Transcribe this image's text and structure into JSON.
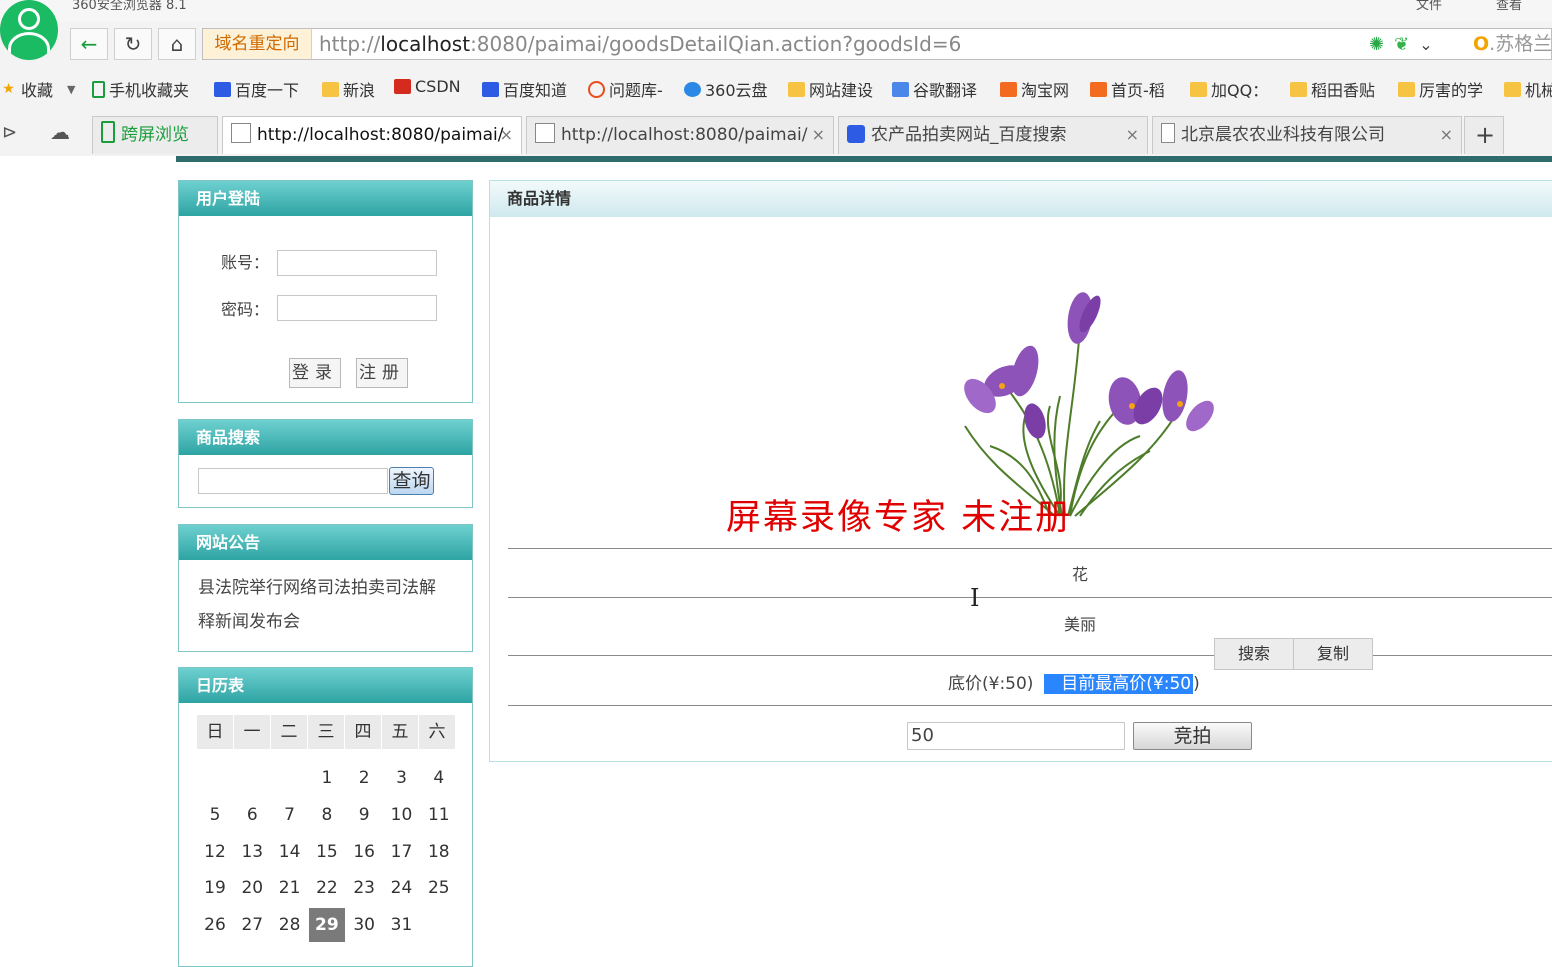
{
  "browser": {
    "app_title": "360安全浏览器 8.1",
    "menu": {
      "file": "文件",
      "view": "查看"
    },
    "address": {
      "redirect_tag": "域名重定向",
      "url_scheme": "http://",
      "url_host": "localhost",
      "url_rest": ":8080/paimai/goodsDetailQian.action?goodsId=6",
      "search_engine": "苏格兰"
    },
    "bookmarks": [
      {
        "label": "收藏",
        "icon": "star-icon"
      },
      {
        "label": "手机收藏夹",
        "icon": "phone-icon"
      },
      {
        "label": "百度一下",
        "icon": "baidu-paw-icon"
      },
      {
        "label": "新浪",
        "icon": "folder-icon"
      },
      {
        "label": "CSDN",
        "icon": "csdn-icon"
      },
      {
        "label": "百度知道",
        "icon": "baidu-paw-icon"
      },
      {
        "label": "问题库-",
        "icon": "sogou-icon"
      },
      {
        "label": "360云盘",
        "icon": "cloud-icon"
      },
      {
        "label": "网站建设",
        "icon": "folder-icon"
      },
      {
        "label": "谷歌翻译",
        "icon": "translate-icon"
      },
      {
        "label": "淘宝网",
        "icon": "taobao-icon"
      },
      {
        "label": "首页-稻",
        "icon": "taobao-icon"
      },
      {
        "label": "加QQ：",
        "icon": "folder-icon"
      },
      {
        "label": "稻田香贴",
        "icon": "folder-icon"
      },
      {
        "label": "厉害的学",
        "icon": "folder-icon"
      },
      {
        "label": "机械",
        "icon": "folder-icon"
      }
    ],
    "tabs": [
      {
        "label": "跨屏浏览"
      },
      {
        "label": "http://localhost:8080/paimai/"
      },
      {
        "label": "http://localhost:8080/paimai/"
      },
      {
        "label": "农产品拍卖网站_百度搜索"
      },
      {
        "label": "北京晨农农业科技有限公司"
      }
    ]
  },
  "login": {
    "title": "用户登陆",
    "account_label": "账号：",
    "password_label": "密码：",
    "account_value": "",
    "password_value": "",
    "login_button": "登录",
    "register_button": "注册"
  },
  "search": {
    "title": "商品搜索",
    "query_value": "",
    "query_button": "查询"
  },
  "notice": {
    "title": "网站公告",
    "text": "县法院举行网络司法拍卖司法解释新闻发布会"
  },
  "calendar": {
    "title": "日历表",
    "weekdays": [
      "日",
      "一",
      "二",
      "三",
      "四",
      "五",
      "六"
    ],
    "first_weekday_index": 3,
    "days_in_month": 31,
    "today": 29
  },
  "detail": {
    "title": "商品详情",
    "image_alt": "紫色番红花",
    "watermark": "屏幕录像专家  未注册",
    "goods_name": "花",
    "goods_desc": "美丽",
    "base_price": "底价(¥:50)",
    "highest_price": "目前最高价(¥:50",
    "highest_price_tail": ")",
    "context_menu": [
      "搜索",
      "复制"
    ],
    "bid_value": "50",
    "bid_button": "竞拍"
  },
  "colors": {
    "panel_header": "#2ea3a3",
    "page_strip": "#2e6b6a",
    "watermark": "#e00000",
    "selection": "#2a86ff",
    "brand_green": "#1bbb64"
  }
}
